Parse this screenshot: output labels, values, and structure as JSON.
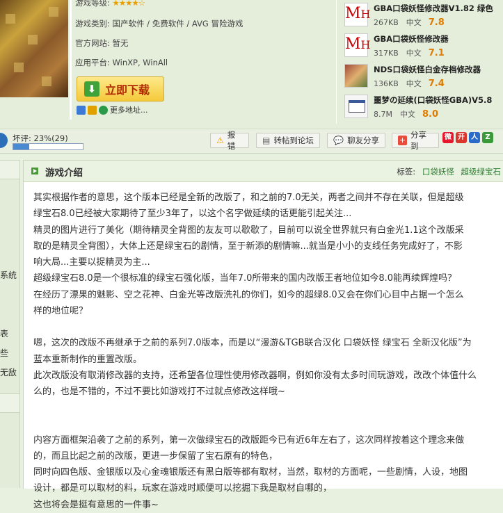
{
  "game_info": {
    "rating_label": "游戏等级:",
    "stars": "★★★★☆",
    "category_label": "游戏类别:",
    "category_value": "国产软件 / 免费软件 / AVG 冒险游戏",
    "website_label": "官方网站:",
    "website_value": "暂无",
    "platform_label": "应用平台:",
    "platform_value": "WinXP, WinAll",
    "download_label": "立即下载",
    "more_label": "更多地址..."
  },
  "related": [
    {
      "title": "GBA口袋妖怪修改器V1.82 绿色",
      "size": "267KB",
      "lang": "中文",
      "score": "7.8",
      "icon": "mh-icon"
    },
    {
      "title": "GBA口袋妖怪修改器",
      "size": "317KB",
      "lang": "中文",
      "score": "7.1",
      "icon": "mh-icon"
    },
    {
      "title": "NDS口袋妖怪白金存档修改器",
      "size": "136KB",
      "lang": "中文",
      "score": "7.4",
      "icon": "game-icon"
    },
    {
      "title": "噩梦の延续(口袋妖怪GBA)V5.8",
      "size": "8.7M",
      "lang": "中文",
      "score": "8.0",
      "icon": "window-icon"
    }
  ],
  "action_bar": {
    "bad_label": "坏评: 23%(29)",
    "bad_fraction": 0.23,
    "report": "报错",
    "forum": "转帖到论坛",
    "chat": "聊友分享",
    "share": "分享到"
  },
  "sidebar": {
    "t1": "系统",
    "t2": "表",
    "t3": "些",
    "t4": "无敌"
  },
  "section": {
    "title": "游戏介绍",
    "tags_label": "标签:",
    "tag1": "口袋妖怪",
    "tag2": "超级绿宝石"
  },
  "paragraphs": [
    "其实根据作者的意思，这个版本已经是全新的改版了，和之前的7.0无关，两者之间并不存在关联，但是超级",
    "绿宝石8.0已经被大家期待了至少3年了，以这个名字做延续的话更能引起关注...",
    "精灵的图片进行了美化（期待精灵全背图的友友可以歇歇了，目前可以说全世界就只有白金光1.1这个改版采",
    "取的是精灵全背图），大体上还是绿宝石的剧情，至于新添的剧情嘛...就当是小小的支线任务完成好了，不影",
    "响大局...主要以捉精灵为主...",
    "超级绿宝石8.0是一个很标准的绿宝石强化版，当年7.0所带来的国内改版王者地位如今8.0能再续辉煌吗？",
    "在经历了漂果的魅影、空之花神、白金光等改版洗礼的你们，如今的超绿8.0又会在你们心目中占据一个怎么",
    "样的地位呢？",
    "",
    "嗯，这次的改版不再继承于之前的系列7.0版本，而是以“漫游&TGB联合汉化 口袋妖怪 绿宝石 全新汉化版”为",
    "蓝本重新制作的重置改版。",
    "此次改版没有取消修改器的支持，还希望各位理性使用修改器啊，例如你没有太多时间玩游戏，改改个体值什么",
    "么的，也是不错的，不过不要比如游戏打不过就点修改这样哦~",
    "",
    "",
    "内容方面框架沿袭了之前的系列，第一次做绿宝石的改版距今已有近6年左右了，这次同样按着这个理念来做",
    "的，而且比起之前的改版，更进一步保留了宝石原有的特色，",
    "同时向四色版、金银版以及心金魂银版还有黑白版等都有取材，当然，取材的方面呢，一些剧情，人设，地图",
    "设计，都是可以取材的料，玩家在游戏时顺便可以挖掘下我是取材自哪的，",
    "这也将会是挺有意思的一件事~"
  ]
}
